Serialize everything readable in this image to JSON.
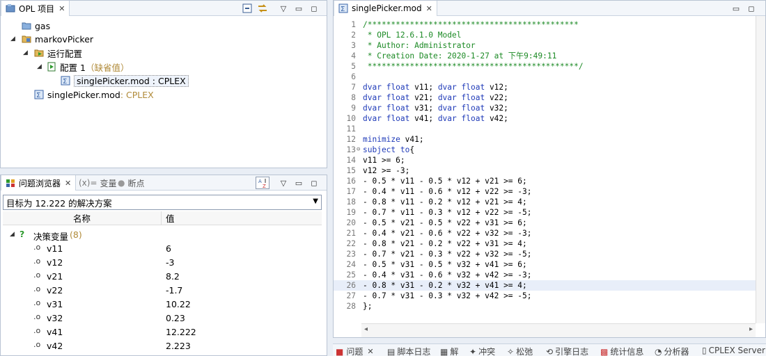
{
  "project_panel": {
    "tab_label": "OPL 项目",
    "tree": [
      {
        "label": "gas",
        "icon": "folder-icon"
      },
      {
        "label": "markovPicker",
        "icon": "project-icon"
      },
      {
        "label": "运行配置",
        "icon": "run-config-folder-icon"
      },
      {
        "label": "配置 1",
        "suffix": "（缺省值）",
        "icon": "config-icon"
      },
      {
        "label": "singlePicker.mod : CPLEX",
        "icon": "model-file-icon"
      },
      {
        "label": "singlePicker.mod",
        "suffix": " : CPLEX",
        "icon": "model-file-icon"
      }
    ]
  },
  "browser_panel": {
    "tabs": [
      "问题浏览器",
      "变量",
      "断点"
    ],
    "combo_value": "目标为 12.222 的解决方案",
    "col_name": "名称",
    "col_value": "值",
    "group": {
      "label": "决策变量",
      "count": "(8)"
    },
    "variables": [
      {
        "name": "v11",
        "value": "6"
      },
      {
        "name": "v12",
        "value": "-3"
      },
      {
        "name": "v21",
        "value": "8.2"
      },
      {
        "name": "v22",
        "value": "-1.7"
      },
      {
        "name": "v31",
        "value": "10.22"
      },
      {
        "name": "v32",
        "value": "0.23"
      },
      {
        "name": "v41",
        "value": "12.222"
      },
      {
        "name": "v42",
        "value": "2.223"
      }
    ]
  },
  "editor": {
    "tab_label": "singlePicker.mod",
    "lines": [
      "/*********************************************",
      " * OPL 12.6.1.0 Model",
      " * Author: Administrator",
      " * Creation Date: 2020-1-27 at 下午9:49:11",
      " *********************************************/",
      "",
      "dvar float v11; dvar float v12;",
      "dvar float v21; dvar float v22;",
      "dvar float v31; dvar float v32;",
      "dvar float v41; dvar float v42;",
      "",
      "minimize v41;",
      "subject to{",
      "v11 >= 6;",
      "v12 >= -3;",
      "- 0.5 * v11 - 0.5 * v12 + v21 >= 6;",
      "- 0.4 * v11 - 0.6 * v12 + v22 >= -3;",
      "- 0.8 * v11 - 0.2 * v12 + v21 >= 4;",
      "- 0.7 * v11 - 0.3 * v12 + v22 >= -5;",
      "- 0.5 * v21 - 0.5 * v22 + v31 >= 6;",
      "- 0.4 * v21 - 0.6 * v22 + v32 >= -3;",
      "- 0.8 * v21 - 0.2 * v22 + v31 >= 4;",
      "- 0.7 * v21 - 0.3 * v22 + v32 >= -5;",
      "- 0.5 * v31 - 0.5 * v32 + v41 >= 6;",
      "- 0.4 * v31 - 0.6 * v32 + v42 >= -3;",
      "- 0.8 * v31 - 0.2 * v32 + v41 >= 4;",
      "- 0.7 * v31 - 0.3 * v32 + v42 >= -5;",
      "};"
    ],
    "highlighted_line": 26
  },
  "bottom_tabs": [
    "问题",
    "脚本日志",
    "解",
    "冲突",
    "松弛",
    "引擎日志",
    "统计信息",
    "分析器",
    "CPLEX Server"
  ]
}
